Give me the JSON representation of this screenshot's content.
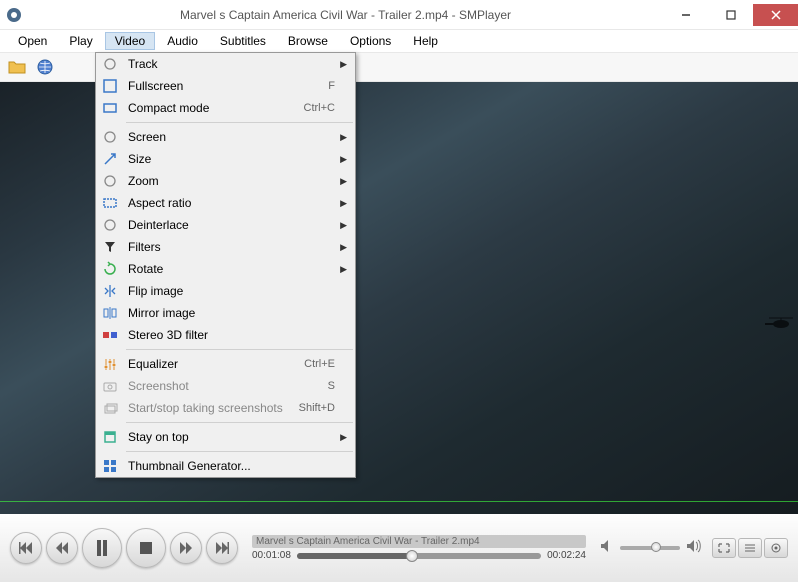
{
  "window": {
    "title": "Marvel s Captain America  Civil War - Trailer 2.mp4 - SMPlayer"
  },
  "menubar": [
    "Open",
    "Play",
    "Video",
    "Audio",
    "Subtitles",
    "Browse",
    "Options",
    "Help"
  ],
  "active_menu_index": 2,
  "dropdown": {
    "items": [
      {
        "icon": "track",
        "label": "Track",
        "submenu": true
      },
      {
        "icon": "fullscreen",
        "label": "Fullscreen",
        "accel": "F"
      },
      {
        "icon": "compact",
        "label": "Compact mode",
        "accel": "Ctrl+C"
      },
      {
        "sep": true
      },
      {
        "icon": "screen",
        "label": "Screen",
        "submenu": true
      },
      {
        "icon": "size",
        "label": "Size",
        "submenu": true
      },
      {
        "icon": "zoom",
        "label": "Zoom",
        "submenu": true
      },
      {
        "icon": "aspect",
        "label": "Aspect ratio",
        "submenu": true
      },
      {
        "icon": "deinterlace",
        "label": "Deinterlace",
        "submenu": true
      },
      {
        "icon": "filters",
        "label": "Filters",
        "submenu": true
      },
      {
        "icon": "rotate",
        "label": "Rotate",
        "submenu": true
      },
      {
        "icon": "flip",
        "label": "Flip image"
      },
      {
        "icon": "mirror",
        "label": "Mirror image"
      },
      {
        "icon": "stereo3d",
        "label": "Stereo 3D filter"
      },
      {
        "sep": true
      },
      {
        "icon": "equalizer",
        "label": "Equalizer",
        "accel": "Ctrl+E"
      },
      {
        "icon": "screenshot",
        "label": "Screenshot",
        "accel": "S",
        "disabled": true
      },
      {
        "icon": "screenshots",
        "label": "Start/stop taking screenshots",
        "accel": "Shift+D",
        "disabled": true
      },
      {
        "sep": true
      },
      {
        "icon": "stayontop",
        "label": "Stay on top",
        "submenu": true
      },
      {
        "sep": true
      },
      {
        "icon": "thumbnail",
        "label": "Thumbnail Generator..."
      }
    ]
  },
  "playback": {
    "title": "Marvel s Captain America  Civil War - Trailer 2.mp4",
    "current_time": "00:01:08",
    "total_time": "00:02:24"
  }
}
